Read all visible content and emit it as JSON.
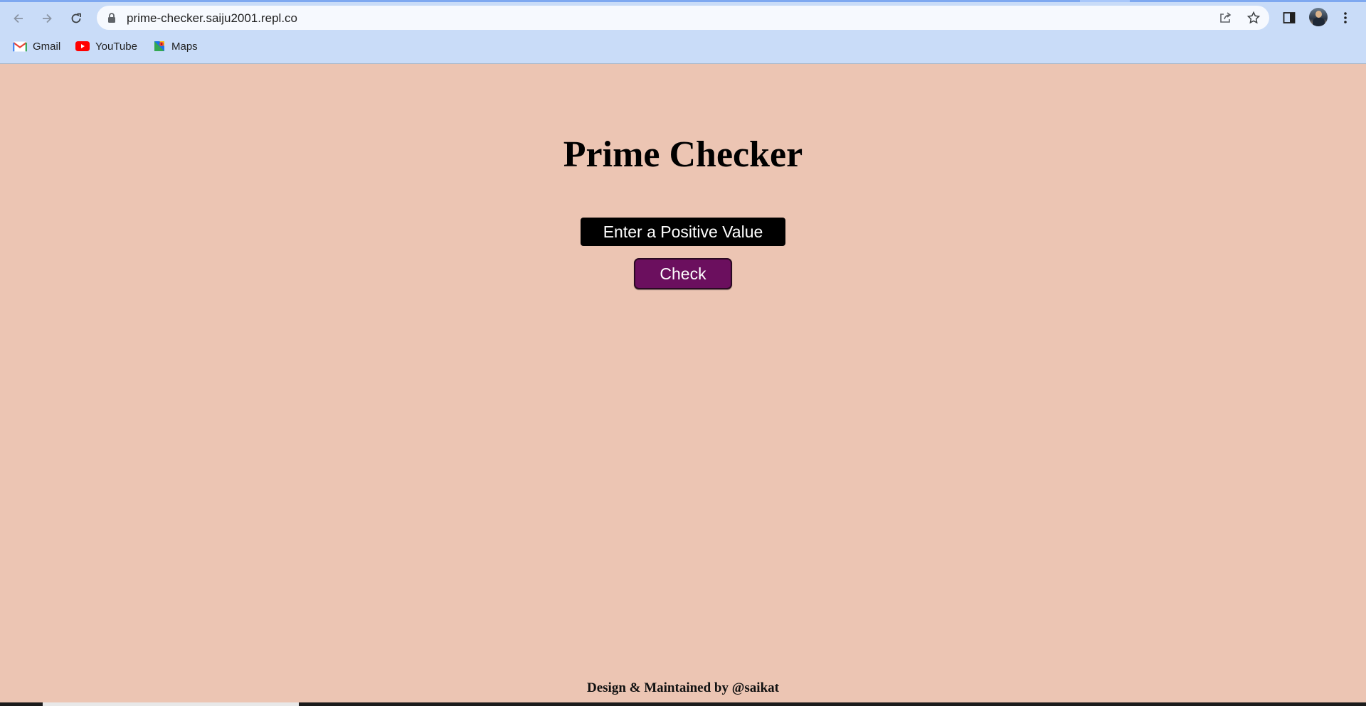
{
  "browser": {
    "url": "prime-checker.saiju2001.repl.co",
    "bookmarks": [
      {
        "label": "Gmail",
        "icon": "gmail-icon"
      },
      {
        "label": "YouTube",
        "icon": "youtube-icon"
      },
      {
        "label": "Maps",
        "icon": "maps-icon"
      }
    ]
  },
  "page": {
    "title": "Prime Checker",
    "input_placeholder": "Enter a Positive Value",
    "input_value": "",
    "check_label": "Check",
    "footer": "Design & Maintained by @saikat"
  },
  "colors": {
    "background": "#ecc5b3",
    "button": "#6b0f5e",
    "input": "#000000"
  }
}
